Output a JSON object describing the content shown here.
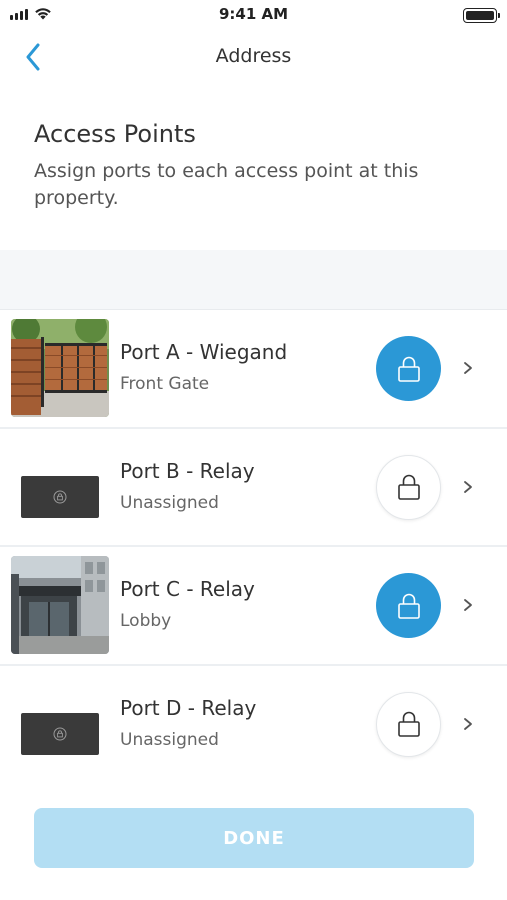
{
  "status_bar": {
    "time": "9:41 AM"
  },
  "nav": {
    "title": "Address"
  },
  "header": {
    "title": "Access Points",
    "subtitle": "Assign ports to each access point at this property."
  },
  "access_points": [
    {
      "title": "Port A - Wiegand",
      "subtitle": "Front Gate",
      "image": "wooden-gate-photo",
      "lock_state": "active"
    },
    {
      "title": "Port B - Relay",
      "subtitle": "Unassigned",
      "image": "keypad-placeholder",
      "lock_state": "inactive"
    },
    {
      "title": "Port C - Relay",
      "subtitle": "Lobby",
      "image": "lobby-entrance-photo",
      "lock_state": "active"
    },
    {
      "title": "Port D - Relay",
      "subtitle": "Unassigned",
      "image": "keypad-placeholder",
      "lock_state": "inactive"
    }
  ],
  "done_button": {
    "label": "DONE",
    "enabled": false
  },
  "colors": {
    "accent": "#2b98d6",
    "done_disabled": "#b3def3"
  }
}
